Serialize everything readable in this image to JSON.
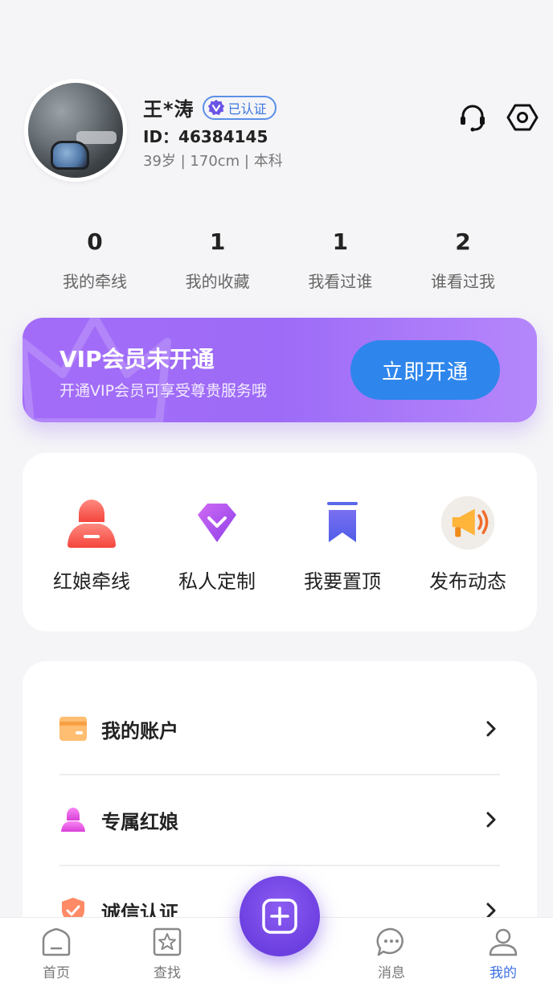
{
  "profile": {
    "name": "王*涛",
    "verified_label": "已认证",
    "id_text": "ID：46384145",
    "info_text": "39岁 | 170cm | 本科"
  },
  "top_icons": [
    "headset-icon",
    "settings-hexagon-icon"
  ],
  "stats": [
    {
      "value": "0",
      "label": "我的牵线"
    },
    {
      "value": "1",
      "label": "我的收藏"
    },
    {
      "value": "1",
      "label": "我看过谁"
    },
    {
      "value": "2",
      "label": "谁看过我"
    }
  ],
  "vip": {
    "title": "VIP会员未开通",
    "subtitle": "开通VIP会员可享受尊贵服务哦",
    "button_label": "立即开通"
  },
  "features": [
    {
      "label": "红娘牵线",
      "icon": "matchmaker-icon"
    },
    {
      "label": "私人定制",
      "icon": "diamond-icon"
    },
    {
      "label": "我要置顶",
      "icon": "bookmark-icon"
    },
    {
      "label": "发布动态",
      "icon": "megaphone-icon"
    }
  ],
  "menu": [
    {
      "label": "我的账户",
      "icon": "wallet-icon"
    },
    {
      "label": "专属红娘",
      "icon": "person-icon"
    },
    {
      "label": "诚信认证",
      "icon": "shield-check-icon"
    }
  ],
  "tabs": [
    {
      "label": "首页",
      "icon": "home-icon"
    },
    {
      "label": "查找",
      "icon": "star-search-icon"
    },
    {
      "label": "消息",
      "icon": "chat-icon"
    },
    {
      "label": "我的",
      "icon": "user-icon"
    }
  ],
  "colors": {
    "accent_blue": "#2e86ec",
    "vip_purple": "#a36cf8",
    "active_tab": "#3b6fe3",
    "fab_purple": "#6c3fe0"
  }
}
